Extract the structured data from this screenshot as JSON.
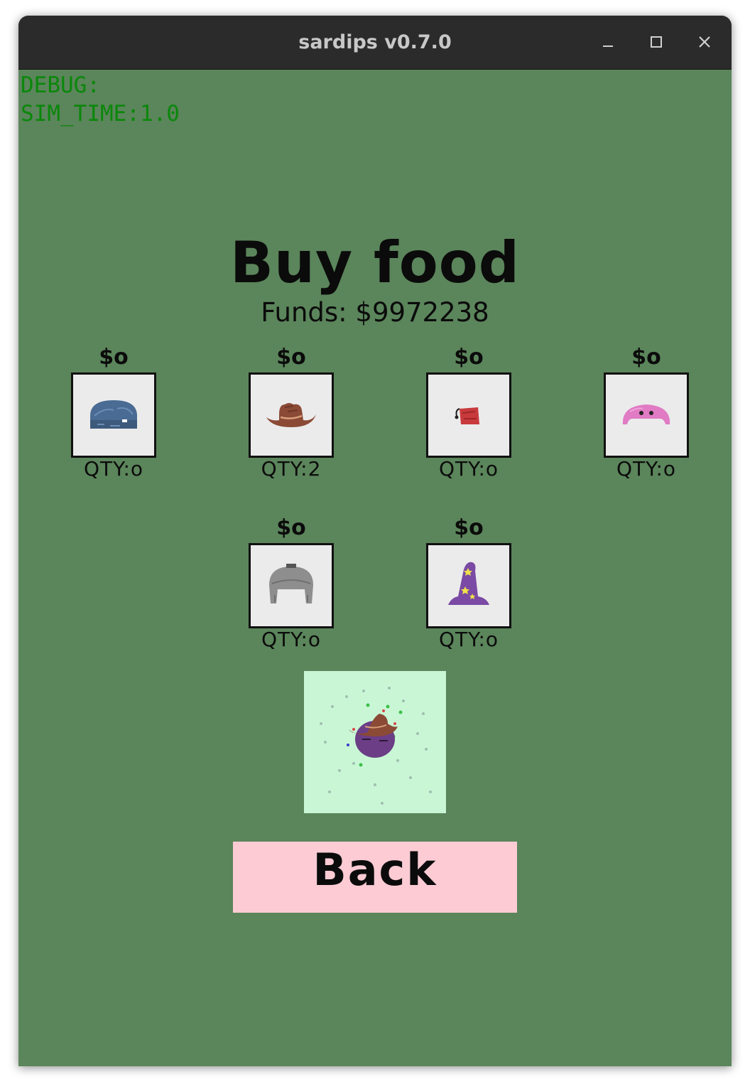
{
  "window": {
    "title": "sardips v0.7.0",
    "controls": {
      "minimize_icon": "minimize-icon",
      "maximize_icon": "maximize-icon",
      "close_icon": "close-icon"
    }
  },
  "debug": {
    "line1": "DEBUG:",
    "line2": "SIM_TIME:1.0"
  },
  "page": {
    "title": "Buy food",
    "funds": "Funds: $9972238"
  },
  "items": [
    {
      "price": "$o",
      "qty": "QTY:o",
      "icon": "blue-beanie-icon"
    },
    {
      "price": "$o",
      "qty": "QTY:2",
      "icon": "cowboy-hat-icon"
    },
    {
      "price": "$o",
      "qty": "QTY:o",
      "icon": "red-fez-icon"
    },
    {
      "price": "$o",
      "qty": "QTY:o",
      "icon": "pink-cap-icon"
    },
    {
      "price": "$o",
      "qty": "QTY:o",
      "icon": "trapper-hat-icon"
    },
    {
      "price": "$o",
      "qty": "QTY:o",
      "icon": "wizard-hat-icon"
    }
  ],
  "preview": {
    "icon": "pet-preview-icon"
  },
  "back_button": {
    "label": "Back"
  },
  "colors": {
    "background": "#5b855b",
    "titlebar": "#2b2b2b",
    "debug_text": "#0a870a",
    "item_box": "#ebebeb",
    "preview_bg": "#c9f7d6",
    "back_button": "#fccbd4"
  }
}
